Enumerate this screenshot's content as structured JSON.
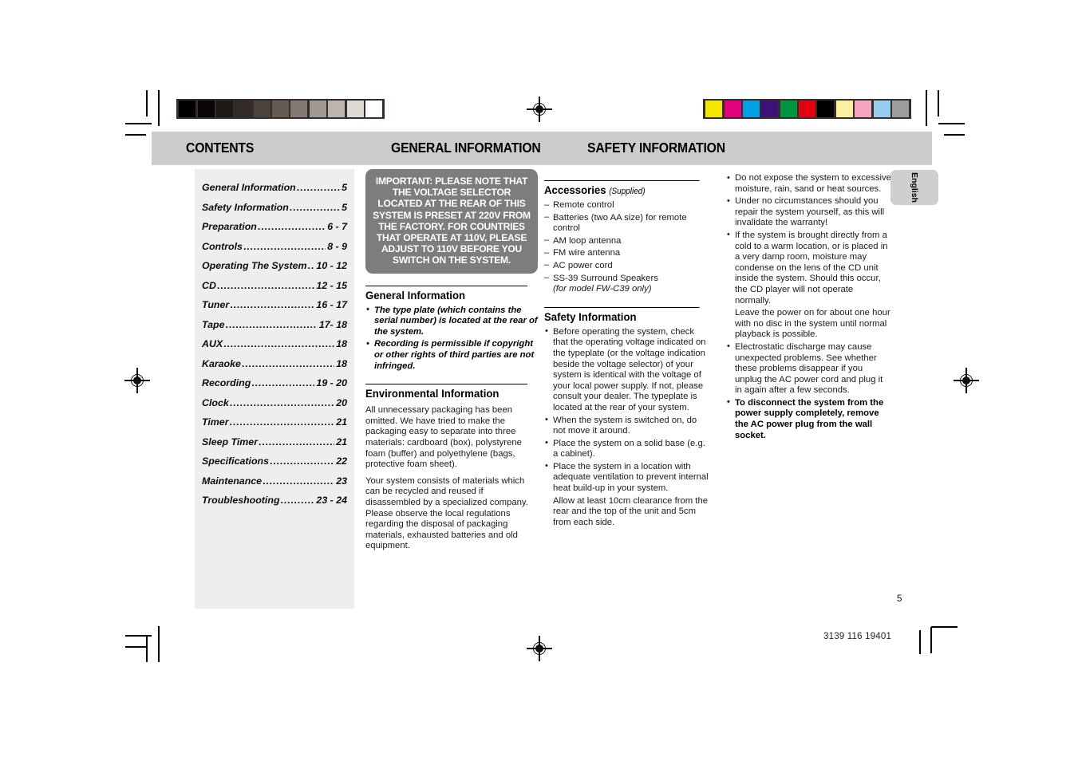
{
  "header": {
    "columns": [
      "CONTENTS",
      "GENERAL INFORMATION",
      "SAFETY INFORMATION"
    ]
  },
  "contents": {
    "items": [
      {
        "title": "General Information",
        "pages": "5"
      },
      {
        "title": "Safety Information",
        "pages": "5"
      },
      {
        "title": "Preparation",
        "pages": "6 - 7"
      },
      {
        "title": "Controls",
        "pages": "8 - 9"
      },
      {
        "title": "Operating The System",
        "pages": "10 - 12"
      },
      {
        "title": "CD",
        "pages": "12 - 15"
      },
      {
        "title": "Tuner",
        "pages": "16 - 17"
      },
      {
        "title": "Tape",
        "pages": "17- 18"
      },
      {
        "title": "AUX",
        "pages": "18"
      },
      {
        "title": "Karaoke",
        "pages": "18"
      },
      {
        "title": "Recording",
        "pages": "19 - 20"
      },
      {
        "title": "Clock",
        "pages": "20"
      },
      {
        "title": "Timer",
        "pages": "21"
      },
      {
        "title": "Sleep Timer",
        "pages": "21"
      },
      {
        "title": "Specifications",
        "pages": "22"
      },
      {
        "title": "Maintenance",
        "pages": "23"
      },
      {
        "title": "Troubleshooting",
        "pages": "23 - 24"
      }
    ],
    "leader": "................................................................"
  },
  "general_information": {
    "important_notice": "IMPORTANT: PLEASE NOTE THAT THE VOLTAGE SELECTOR LOCATED AT THE REAR OF THIS SYSTEM IS PRESET AT 220V FROM THE FACTORY. FOR COUNTRIES THAT OPERATE AT 110V, PLEASE ADJUST TO 110V BEFORE YOU SWITCH ON THE SYSTEM.",
    "heading": "General Information",
    "bullets": [
      "The type plate (which contains the serial number) is located at the rear of the system.",
      "Recording is permissible if copyright or other rights of third parties are not infringed."
    ],
    "environmental_heading": "Environmental Information",
    "environmental_paragraphs": [
      "All unnecessary packaging has been omitted. We have tried to make the packaging easy to separate into three materials: cardboard (box), polystyrene foam (buffer) and polyethylene (bags, protective foam sheet).",
      "Your system consists of materials which can be recycled and reused if disassembled by a specialized company. Please observe the local regulations regarding the disposal of packaging materials, exhausted batteries and old equipment."
    ]
  },
  "safety_information": {
    "accessories_heading": "Accessories",
    "accessories_sub": "(Supplied)",
    "accessories": [
      "Remote control",
      "Batteries (two AA size) for remote control",
      "AM loop antenna",
      "FM wire antenna",
      "AC power cord",
      "SS-39 Surround Speakers"
    ],
    "accessories_note": "(for model FW-C39 only)",
    "heading": "Safety Information",
    "bullets_col1": [
      "Before operating the system, check that the operating voltage indicated on the typeplate (or the voltage indication beside the voltage selector) of your system is identical with the voltage of your local power supply. If not, please consult your dealer. The typeplate is located at the rear of your system.",
      "When the system is switched on, do not move it around.",
      "Place the system on a solid base (e.g. a cabinet).",
      "Place the system in a location with adequate ventilation to prevent internal heat build-up in your system."
    ],
    "bullets_col1_extra": "Allow at least 10cm clearance from the rear and the top of the unit and 5cm from each side.",
    "bullets_col2": [
      "Do not expose the system to excessive moisture, rain, sand or heat sources.",
      "Under no circumstances should you repair the system yourself, as this will invalidate the warranty!",
      "If the system is brought directly from a cold to a warm location, or is placed in a very damp room, moisture may condense on the lens of the CD unit inside the system. Should this occur, the CD player will not operate normally."
    ],
    "bullets_col2_extra": "Leave the power on for about one hour with no disc in the system until normal playback is possible.",
    "bullets_col2_rest": [
      "Electrostatic discharge may cause unexpected problems. See whether these problems disappear if you unplug the AC power cord and plug it in again after a few seconds."
    ],
    "bullet_bold": "To disconnect the system from the power supply completely, remove the AC power plug from the wall socket."
  },
  "side_tab": {
    "label": "English"
  },
  "footer": {
    "page_number": "5",
    "document_id": "3139 116 19401"
  },
  "calibration": {
    "grayscale": [
      "#000000",
      "#0a0506",
      "#1f1a17",
      "#312a26",
      "#4a423c",
      "#645b55",
      "#837a74",
      "#a09892",
      "#bcb5af",
      "#ddd8d2",
      "#ffffff"
    ],
    "colors": [
      "#f3e600",
      "#e5007d",
      "#00a0e3",
      "#3c1178",
      "#009640",
      "#e3000f",
      "#000000",
      "#faf0a0",
      "#f5a3c0",
      "#97cdf0",
      "#9d9d9c"
    ]
  }
}
